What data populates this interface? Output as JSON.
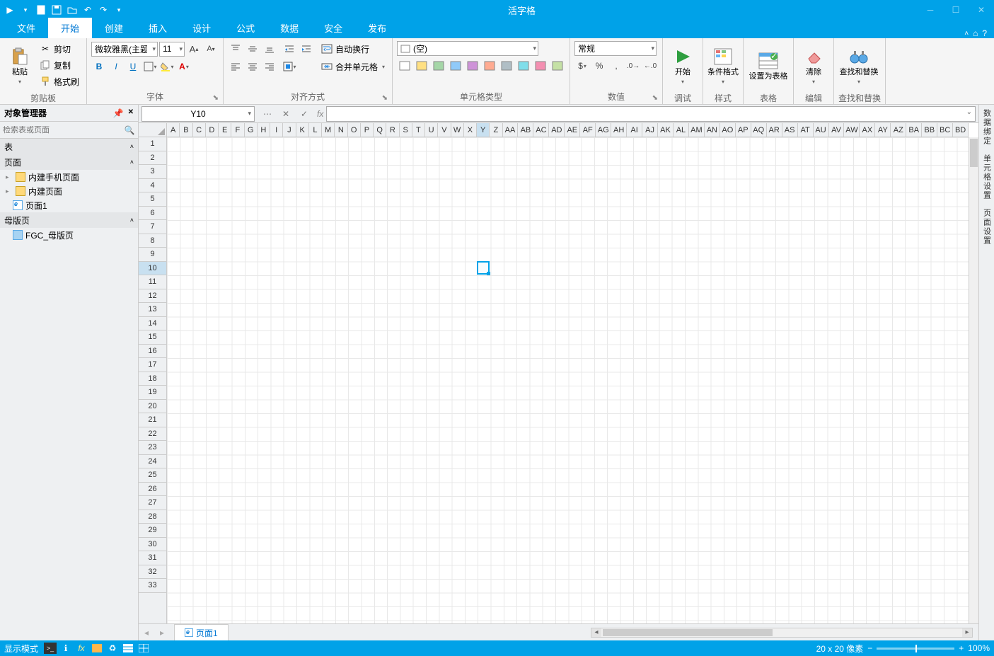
{
  "app": {
    "title": "活字格"
  },
  "qat": {
    "items": [
      "run",
      "new",
      "save",
      "open",
      "undo",
      "redo"
    ]
  },
  "menu": {
    "tabs": [
      "文件",
      "开始",
      "创建",
      "插入",
      "设计",
      "公式",
      "数据",
      "安全",
      "发布"
    ],
    "active": 1
  },
  "ribbon": {
    "clipboard": {
      "paste": "粘贴",
      "cut": "剪切",
      "copy": "复制",
      "formatPainter": "格式刷",
      "label": "剪贴板"
    },
    "font": {
      "name": "微软雅黑(主题字体)",
      "size": "11",
      "bold": "B",
      "italic": "I",
      "underline": "U",
      "label": "字体"
    },
    "align": {
      "wrap": "自动换行",
      "merge": "合并单元格",
      "label": "对齐方式"
    },
    "celltype": {
      "empty": "(空)",
      "label": "单元格类型"
    },
    "number": {
      "format": "常规",
      "label": "数值"
    },
    "start": {
      "text": "开始",
      "debug": "调试"
    },
    "style": {
      "cond": "条件格式",
      "label": "样式"
    },
    "table": {
      "setAsTable": "设置为表格",
      "label": "表格"
    },
    "edit": {
      "clear": "清除",
      "label": "编辑"
    },
    "find": {
      "findReplace": "查找和替换",
      "label": "查找和替换"
    }
  },
  "objmgr": {
    "title": "对象管理器",
    "searchPlaceholder": "检索表或页面",
    "sections": {
      "tables": "表",
      "pages": "页面",
      "master": "母版页"
    },
    "tree": {
      "mobilePages": "内建手机页面",
      "builtinPages": "内建页面",
      "page1": "页面1",
      "master1": "FGC_母版页"
    }
  },
  "cellref": {
    "name": "Y10"
  },
  "grid": {
    "columns": [
      "A",
      "B",
      "C",
      "D",
      "E",
      "F",
      "G",
      "H",
      "I",
      "J",
      "K",
      "L",
      "M",
      "N",
      "O",
      "P",
      "Q",
      "R",
      "S",
      "T",
      "U",
      "V",
      "W",
      "X",
      "Y",
      "Z",
      "AA",
      "AB",
      "AC",
      "AD",
      "AE",
      "AF",
      "AG",
      "AH",
      "AI",
      "AJ",
      "AK",
      "AL",
      "AM",
      "AN",
      "AO",
      "AP",
      "AQ",
      "AR",
      "AS",
      "AT",
      "AU",
      "AV",
      "AW",
      "AX",
      "AY",
      "AZ",
      "BA",
      "BB",
      "BC",
      "BD"
    ],
    "rowCount": 33,
    "selCol": 24,
    "selRow": 9
  },
  "sheets": {
    "active": "页面1"
  },
  "rightTabs": [
    "数据绑定",
    "单元格设置",
    "页面设置"
  ],
  "status": {
    "mode": "显示模式",
    "pixel": "20 x 20 像素",
    "zoom": "100%"
  }
}
